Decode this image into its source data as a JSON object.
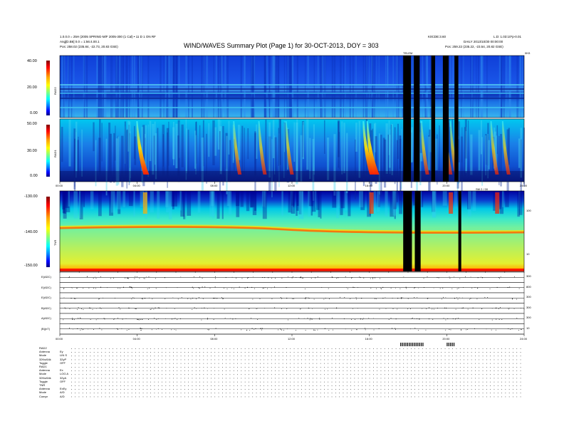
{
  "header": {
    "left_line1": "1.0.0.0 = 25H (2005 SPRING-M/F 2005-300 (1 Cal)  • 11 D 1 ON RF",
    "left_line2": "Ang[D.B6] 0.0 = 1:56:4.00.1",
    "left_line3": "Pos:    258.02 (235.84, -22.73, 20.83 GSE)",
    "right_line1": "K0CDE:3.60",
    "right_line2": "DAILY  2013/10/30 00:00:00",
    "right_line2b": "L.D: 1.03:10*p-0.01",
    "right_line3": "Pos:    259.22 (235.22, -23.54, 20.82 GSE)",
    "title": "WIND/WAVES Summary Plot (Page 1) for 30-OCT-2013, DOY = 303",
    "telemetry_flag": "TELEM",
    "mid_flag": "SM 2 / 00",
    "top_right_corner": "0H3"
  },
  "chart_data": [
    {
      "type": "heatmap",
      "name_in_image": "RAD2",
      "ylabel": "RAD2",
      "yticks": [
        "40.00",
        "20.00",
        "0.00"
      ],
      "ylim": [
        0,
        40
      ],
      "xlim": [
        0,
        24
      ]
    },
    {
      "type": "heatmap",
      "name_in_image": "RAD1",
      "ylabel": "RAD1",
      "yticks": [
        "50.00",
        "30.00",
        "0.00"
      ],
      "ylim": [
        0,
        50
      ],
      "xtick_labels": [
        "00:00",
        "04:00",
        "08:00",
        "12:00",
        "16:00",
        "20:00",
        "24:00"
      ],
      "xticks": [
        0,
        4,
        8,
        12,
        16,
        20,
        24
      ],
      "bursts_hour": [
        4.1,
        9.1,
        10.4,
        11.8,
        15.8,
        16.0,
        18.8,
        20.0,
        20.3,
        22.4,
        23.0
      ],
      "data_gaps_hour": [
        [
          17.75,
          18.15
        ],
        [
          18.3,
          18.6
        ],
        [
          19.2,
          19.4
        ],
        [
          19.8,
          20.1
        ],
        [
          20.4,
          20.6
        ]
      ]
    },
    {
      "type": "heatmap",
      "name_in_image": "TNR",
      "ylabel": "TNR",
      "yticks": [
        "-130.00",
        "-140.00",
        "-150.00"
      ],
      "ylim": [
        -150,
        -130
      ],
      "right_ticks": [
        "100",
        "10"
      ],
      "data_gaps_hour": [
        [
          17.75,
          18.2
        ],
        [
          18.35,
          18.65
        ],
        [
          20.6,
          20.75
        ]
      ]
    },
    {
      "type": "line",
      "name_in_image": "housekeeping",
      "rows": [
        {
          "label": "E(ADC)",
          "right": "300"
        },
        {
          "label": "E(ADC)",
          "right": "800"
        },
        {
          "label": "E(ADC)",
          "right": "300"
        },
        {
          "label": "B(ADC)",
          "right": "300"
        },
        {
          "label": "A(ADC)",
          "right": "300"
        },
        {
          "label": "|B|(nT)",
          "right": "10"
        }
      ],
      "xtick_labels": [
        "00:00",
        "04:00",
        "08:00",
        "12:00",
        "16:00",
        "20:00",
        "24:00"
      ],
      "xticks": [
        0,
        4,
        8,
        12,
        16,
        20,
        24
      ]
    }
  ],
  "modes": [
    {
      "label": "RAD2",
      "value": ""
    },
    {
      "label": "Antenna",
      "value": "Ey"
    },
    {
      "label": "Mode",
      "value": "LIN S"
    },
    {
      "label": "32Ks/64k",
      "value": "32yP"
    },
    {
      "label": "Toggle",
      "value": "OFF"
    },
    {
      "label": "RAD1",
      "value": ""
    },
    {
      "label": "Antenna",
      "value": "Ex"
    },
    {
      "label": "Mode",
      "value": "LOG A"
    },
    {
      "label": "32Ks/64k",
      "value": "32yA"
    },
    {
      "label": "Toggle",
      "value": "OFF"
    },
    {
      "label": "TNR",
      "value": ""
    },
    {
      "label": "Antenna",
      "value": "ExEy"
    },
    {
      "label": "Mode",
      "value": "A/D"
    },
    {
      "label": "Compr",
      "value": "A/D"
    }
  ],
  "colors": {
    "colorbar": [
      "#7f0000",
      "#ff0000",
      "#ffa500",
      "#ffff00",
      "#80ff80",
      "#00ffff",
      "#0080ff",
      "#0000ff",
      "#00007f"
    ]
  }
}
